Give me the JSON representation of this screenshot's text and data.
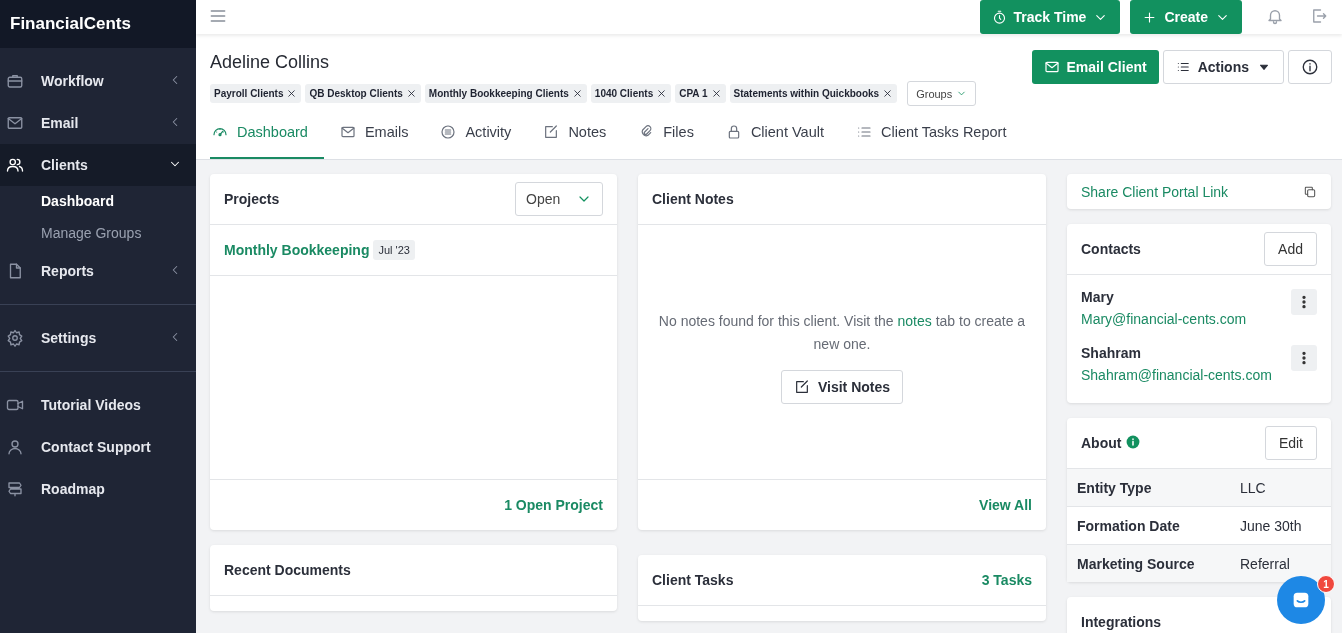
{
  "brand": "FinancialCents",
  "sidebar": {
    "sections": [
      [
        {
          "label": "Workflow",
          "expanded": false,
          "selected": false
        },
        {
          "label": "Email",
          "expanded": false,
          "selected": false
        },
        {
          "label": "Clients",
          "expanded": true,
          "selected": true,
          "children": [
            {
              "label": "Dashboard",
              "selected": true
            },
            {
              "label": "Manage Groups",
              "selected": false
            }
          ]
        },
        {
          "label": "Reports",
          "expanded": false,
          "selected": false
        }
      ],
      [
        {
          "label": "Settings",
          "expanded": false,
          "selected": false
        }
      ],
      [
        {
          "label": "Tutorial Videos"
        },
        {
          "label": "Contact Support"
        },
        {
          "label": "Roadmap"
        }
      ]
    ]
  },
  "topbar": {
    "buttons": [
      {
        "label": "Track Time"
      },
      {
        "label": "Create"
      }
    ]
  },
  "client": {
    "name": "Adeline Collins",
    "tags": [
      "Payroll Clients",
      "QB Desktop Clients",
      "Monthly Bookkeeping Clients",
      "1040 Clients",
      "CPA 1",
      "Statements within Quickbooks"
    ],
    "groups_button": "Groups",
    "actions": {
      "email": "Email Client",
      "menu": "Actions"
    }
  },
  "tabs": [
    {
      "label": "Dashboard",
      "selected": true
    },
    {
      "label": "Emails",
      "selected": false
    },
    {
      "label": "Activity",
      "selected": false
    },
    {
      "label": "Notes",
      "selected": false
    },
    {
      "label": "Files",
      "selected": false
    },
    {
      "label": "Client Vault",
      "selected": false
    },
    {
      "label": "Client Tasks Report",
      "selected": false
    }
  ],
  "projects": {
    "title": "Projects",
    "filter": "Open",
    "items": [
      {
        "name": "Monthly Bookkeeping",
        "date": "Jul '23"
      }
    ],
    "footer": "1 Open Project"
  },
  "notes": {
    "title": "Client Notes",
    "empty_before": "No notes found for this client. Visit the",
    "empty_link": "notes",
    "empty_after": "tab to create a new one.",
    "button": "Visit Notes",
    "footer": "View All"
  },
  "recent_documents": {
    "title": "Recent Documents"
  },
  "tasks": {
    "title": "Client Tasks",
    "count": "3 Tasks"
  },
  "portal": {
    "label": "Share Client Portal Link"
  },
  "contacts": {
    "title": "Contacts",
    "add": "Add",
    "items": [
      {
        "name": "Mary",
        "email": "Mary@financial-cents.com"
      },
      {
        "name": "Shahram",
        "email": "Shahram@financial-cents.com"
      }
    ]
  },
  "about": {
    "title": "About",
    "edit": "Edit",
    "rows": [
      {
        "label": "Entity Type",
        "value": "LLC"
      },
      {
        "label": "Formation Date",
        "value": "June 30th"
      },
      {
        "label": "Marketing Source",
        "value": "Referral"
      }
    ]
  },
  "integrations": {
    "title": "Integrations"
  },
  "chat": {
    "badge": "1"
  }
}
